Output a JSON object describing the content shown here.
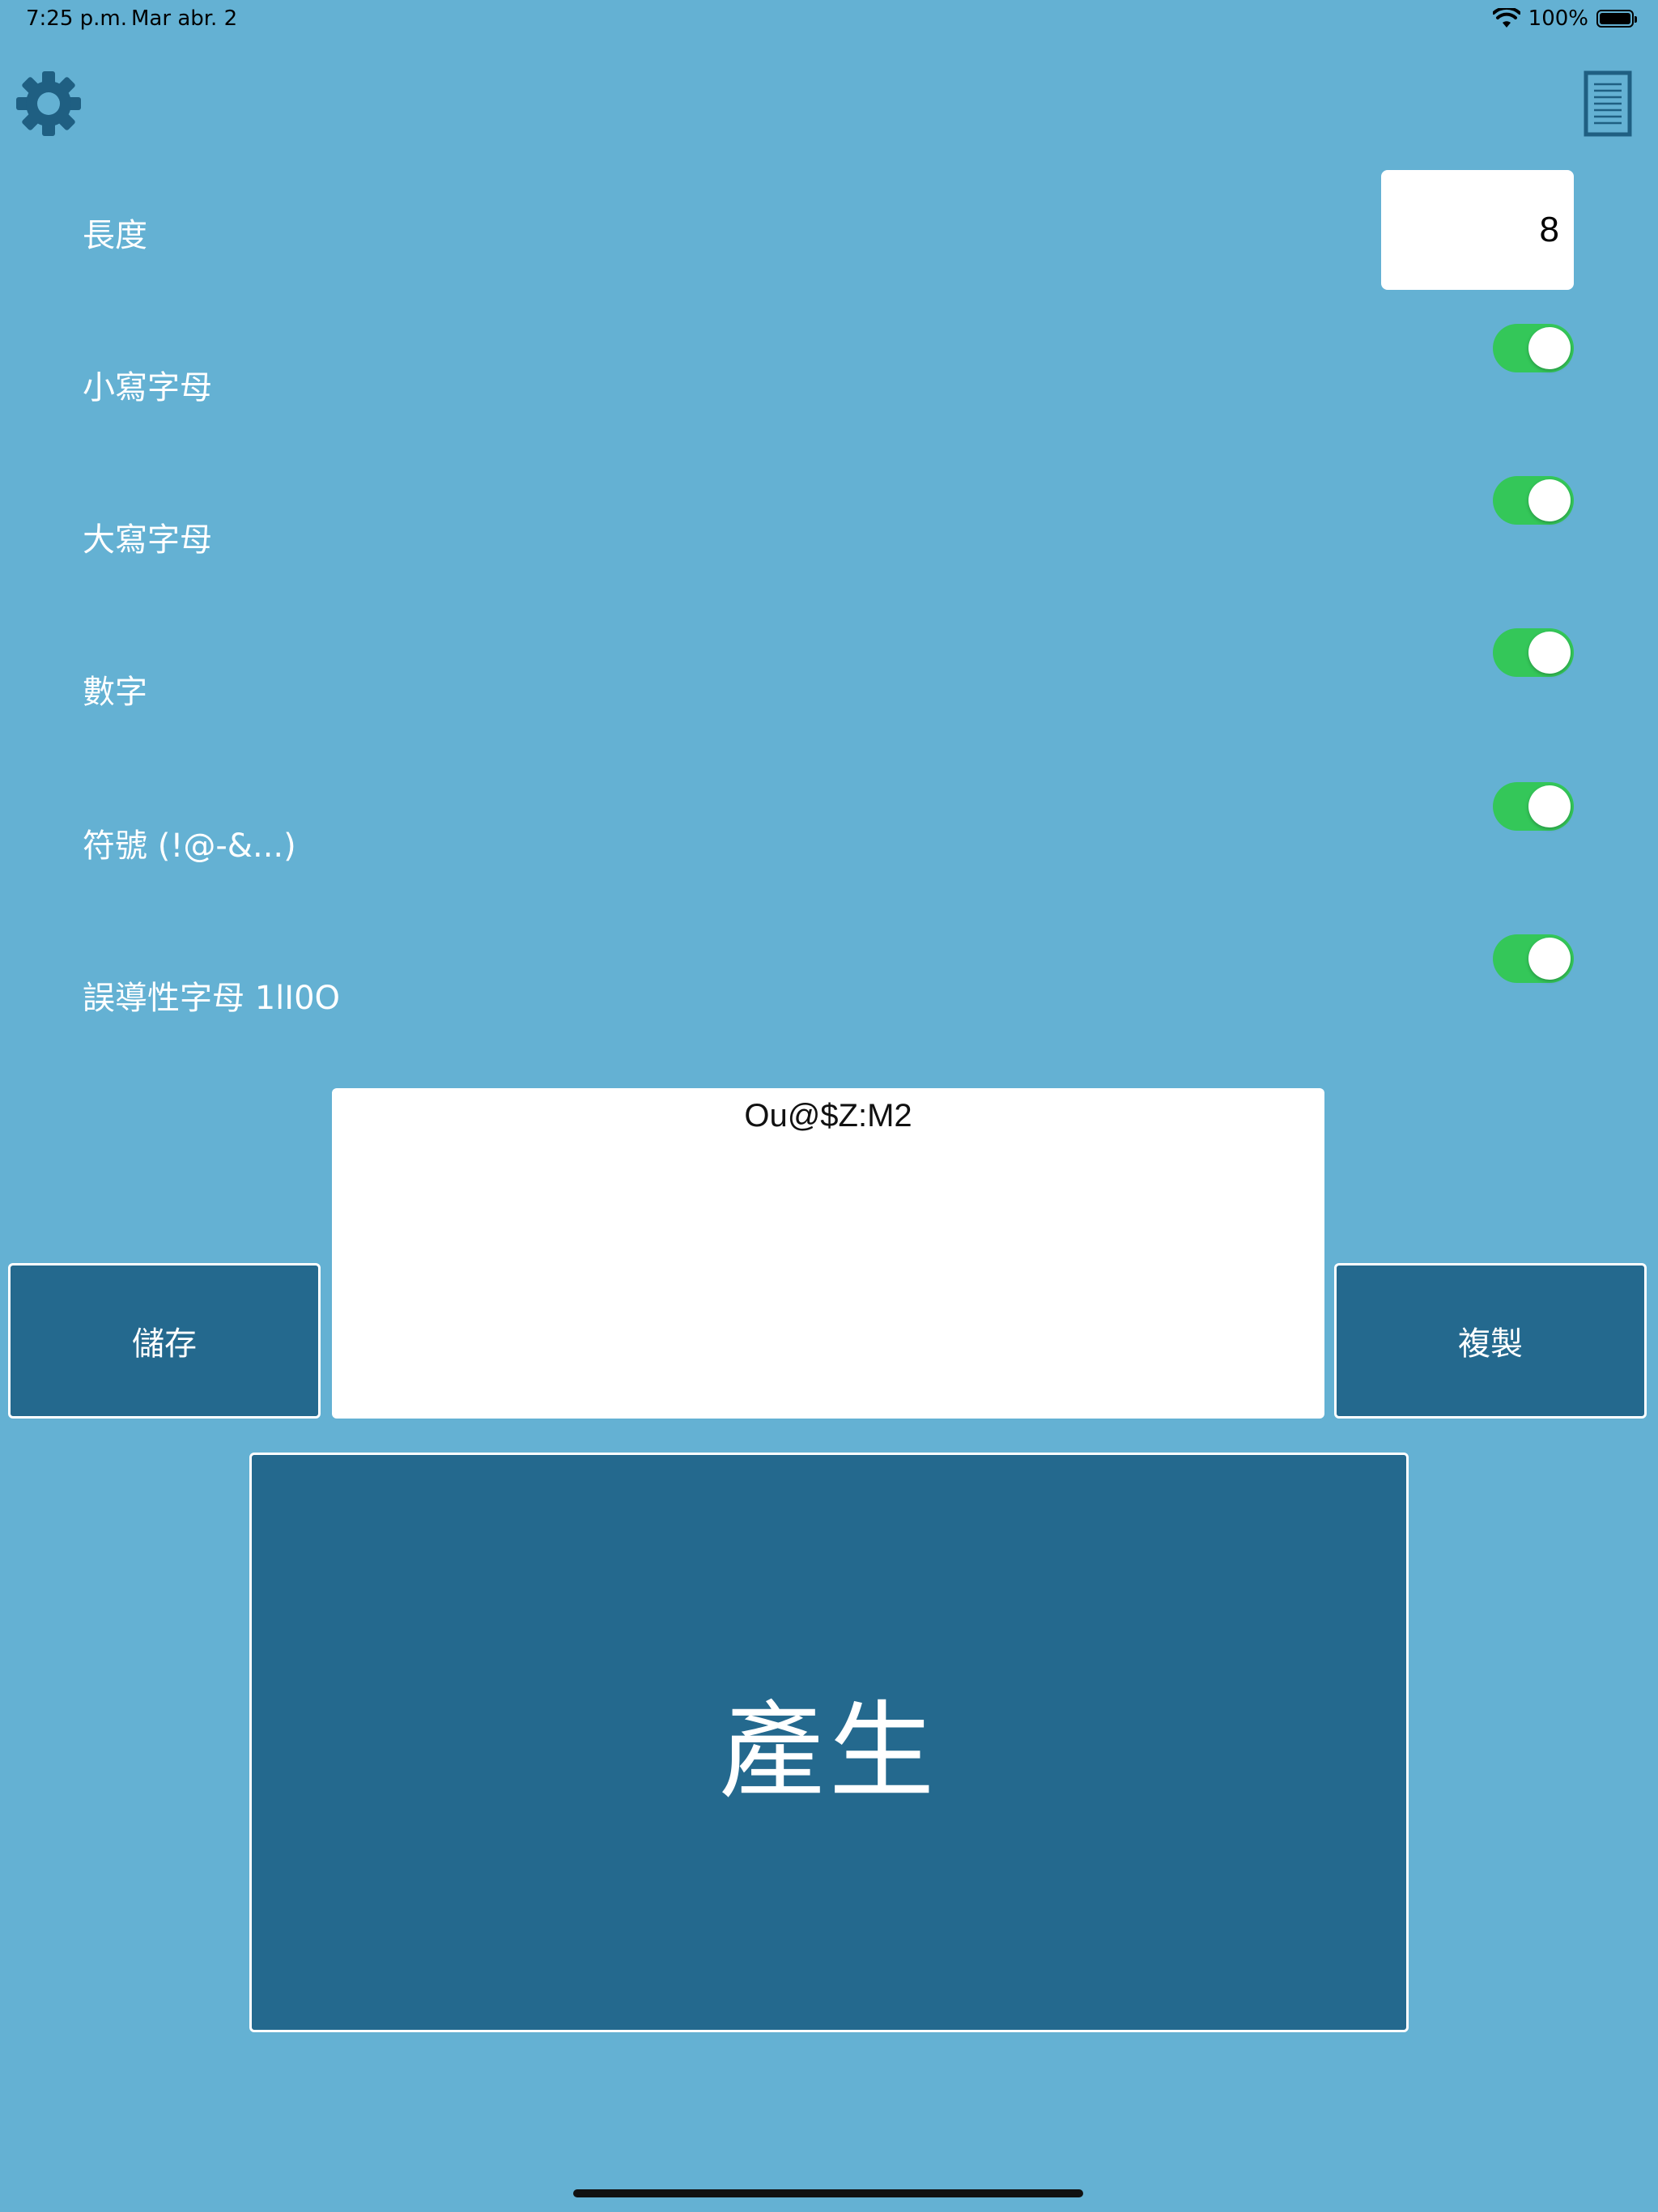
{
  "status_bar": {
    "time": "7:25 p.m.",
    "date": "Mar abr. 2",
    "battery": "100%"
  },
  "toolbar": {
    "settings_icon": "gear-icon",
    "history_icon": "document-icon"
  },
  "options": {
    "length_label": "長度",
    "length_value": "8",
    "toggles": [
      {
        "label": "小寫字母",
        "on": true
      },
      {
        "label": "大寫字母",
        "on": true
      },
      {
        "label": "數字",
        "on": true
      },
      {
        "label": "符號 (!@-&...)",
        "on": true
      },
      {
        "label": "誤導性字母 1lI0O",
        "on": true
      }
    ]
  },
  "output": {
    "password": "Ou@$Z:M2"
  },
  "actions": {
    "save_label": "儲存",
    "copy_label": "複製",
    "generate_label": "產生"
  },
  "colors": {
    "background": "#64b1d3",
    "button": "#24698e",
    "toggle_on": "#34c759"
  }
}
